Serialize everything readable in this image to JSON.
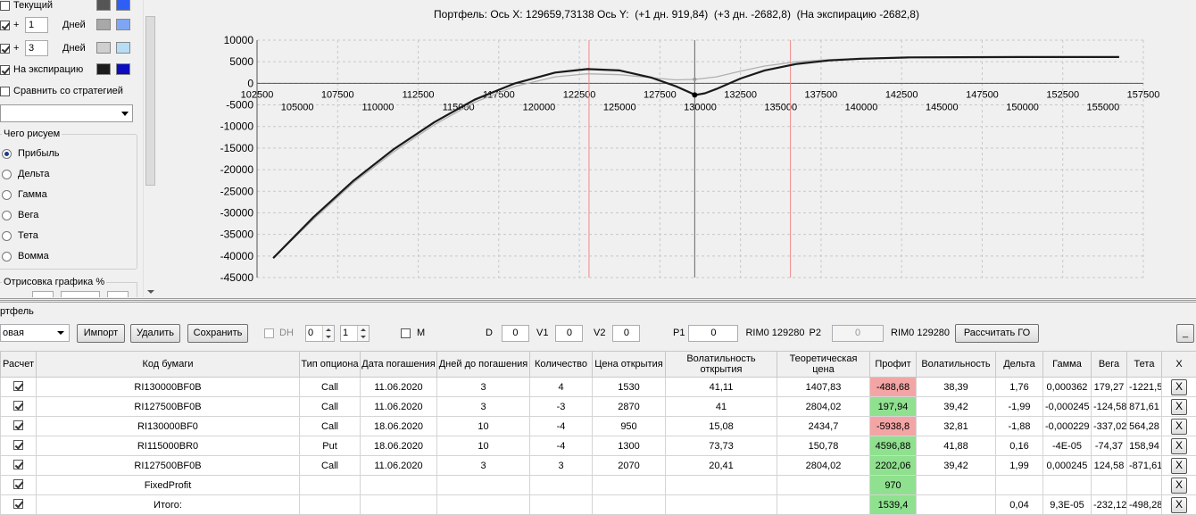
{
  "left_panel": {
    "rows": [
      {
        "label": "Текущий",
        "checked": false,
        "has_days": false,
        "color1": "#555555",
        "color2": "#2f5ef5"
      },
      {
        "prefix": "+",
        "days": "1",
        "days_label": "Дней",
        "checked": true,
        "has_days": true,
        "color1": "#a8a8a8",
        "color2": "#7fa6f5"
      },
      {
        "prefix": "+",
        "days": "3",
        "days_label": "Дней",
        "checked": true,
        "has_days": true,
        "color1": "#cfcfcf",
        "color2": "#b7dcf6"
      },
      {
        "label": "На экспирацию",
        "checked": true,
        "has_days": false,
        "color1": "#1c1c1c",
        "color2": "#0d0dbf"
      }
    ],
    "compare_label": "Сравнить со стратегией",
    "what_group_title": "Чего рисуем",
    "what_options": [
      {
        "label": "Прибыль",
        "selected": true
      },
      {
        "label": "Дельта",
        "selected": false
      },
      {
        "label": "Гамма",
        "selected": false
      },
      {
        "label": "Вега",
        "selected": false
      },
      {
        "label": "Тета",
        "selected": false
      },
      {
        "label": "Вомма",
        "selected": false
      }
    ],
    "draw_group_title": "Отрисовка графика %"
  },
  "chart": {
    "title": "Портфель: Ось X: 129659,73138 Ось Y:  (+1 дн. 919,84)  (+3 дн. -2682,8)  (На экспирацию -2682,8)"
  },
  "chart_data": {
    "type": "line",
    "title": "Портфель: Ось X: 129659,73138 Ось Y:  (+1 дн. 919,84)  (+3 дн. -2682,8)  (На экспирацию -2682,8)",
    "xlim": [
      102500,
      157500
    ],
    "ylim": [
      -45000,
      10000
    ],
    "x_ticks_upper": [
      "102500",
      "107500",
      "112500",
      "117500",
      "122500",
      "127500",
      "132500",
      "137500",
      "142500",
      "147500",
      "152500",
      "157500"
    ],
    "x_ticks_lower": [
      "105000",
      "110000",
      "115000",
      "120000",
      "125000",
      "130000",
      "135000",
      "140000",
      "145000",
      "150000",
      "155000"
    ],
    "y_ticks": [
      "10000",
      "5000",
      "0",
      "-5000",
      "-10000",
      "-15000",
      "-20000",
      "-25000",
      "-30000",
      "-35000",
      "-40000",
      "-45000"
    ],
    "grid": true,
    "cursor_x": 129659.73,
    "red_lines_x": [
      123100,
      135600
    ],
    "series": [
      {
        "color": "#1a1a1a",
        "x": [
          103500,
          106000,
          108500,
          111000,
          113500,
          116000,
          118500,
          121000,
          123000,
          125000,
          127000,
          128500,
          129700,
          130300,
          131000,
          132500,
          134000,
          136000,
          138000,
          140000,
          143000,
          146000,
          150000,
          153000,
          156000
        ],
        "y": [
          -40500,
          -31000,
          -22500,
          -15200,
          -9000,
          -3800,
          0,
          2500,
          3300,
          3000,
          1300,
          -700,
          -2700,
          -2300,
          -1300,
          1100,
          3000,
          4500,
          5300,
          5700,
          6000,
          6050,
          6100,
          6100,
          6100
        ]
      },
      {
        "color": "#b0b0b0",
        "x": [
          103500,
          106000,
          108500,
          111000,
          113500,
          116000,
          118500,
          121000,
          123000,
          125000,
          127000,
          128500,
          129700,
          131000,
          132500,
          134000,
          136000,
          138000,
          140000,
          143000,
          146000,
          150000,
          153000,
          156000
        ],
        "y": [
          -40500,
          -31500,
          -23000,
          -15800,
          -9600,
          -4400,
          -700,
          1500,
          2200,
          2000,
          1300,
          800,
          920,
          1500,
          2800,
          4000,
          5000,
          5500,
          5800,
          6000,
          6050,
          6100,
          6100,
          6100
        ]
      }
    ]
  },
  "portfolio": {
    "section_label": "ртфель",
    "dropdown_value": "овая",
    "import_label": "Импорт",
    "delete_label": "Удалить",
    "save_label": "Сохранить",
    "dh_label": "DH",
    "dh_spin1": "0",
    "dh_spin2": "1",
    "m_label": "M",
    "d_label": "D",
    "d_value": "0",
    "v1_label": "V1",
    "v1_value": "0",
    "v2_label": "V2",
    "v2_value": "0",
    "p1_label": "P1",
    "p1_value": "0",
    "p1_instrument": "RIM0 129280",
    "p2_label": "P2",
    "p2_value": "0",
    "p2_instrument": "RIM0 129280",
    "calc_go_label": "Рассчитать ГО",
    "minimize_label": "_"
  },
  "table": {
    "headers": [
      "Расчет",
      "Код бумаги",
      "Тип опциона",
      "Дата погашения",
      "Дней до погашения",
      "Количество",
      "Цена открытия",
      "Волатильность открытия",
      "Теоретическая цена",
      "Профит",
      "Волатильность",
      "Дельта",
      "Гамма",
      "Вега",
      "Тета",
      "X"
    ],
    "rows": [
      {
        "checked": true,
        "code": "RI130000BF0B",
        "type": "Call",
        "date": "11.06.2020",
        "days": "3",
        "qty": "4",
        "open_price": "1530",
        "open_vol": "41,11",
        "theo": "1407,83",
        "profit": "-488,68",
        "profit_color": "red",
        "vol": "38,39",
        "delta": "1,76",
        "gamma": "0,000362",
        "vega": "179,27",
        "theta": "-1221,5",
        "x": "X"
      },
      {
        "checked": true,
        "code": "RI127500BF0B",
        "type": "Call",
        "date": "11.06.2020",
        "days": "3",
        "qty": "-3",
        "open_price": "2870",
        "open_vol": "41",
        "theo": "2804,02",
        "profit": "197,94",
        "profit_color": "green",
        "vol": "39,42",
        "delta": "-1,99",
        "gamma": "-0,000245",
        "vega": "-124,58",
        "theta": "871,61",
        "x": "X"
      },
      {
        "checked": true,
        "code": "RI130000BF0",
        "type": "Call",
        "date": "18.06.2020",
        "days": "10",
        "qty": "-4",
        "open_price": "950",
        "open_vol": "15,08",
        "theo": "2434,7",
        "profit": "-5938,8",
        "profit_color": "red",
        "vol": "32,81",
        "delta": "-1,88",
        "gamma": "-0,000229",
        "vega": "-337,02",
        "theta": "564,28",
        "x": "X"
      },
      {
        "checked": true,
        "code": "RI115000BR0",
        "type": "Put",
        "date": "18.06.2020",
        "days": "10",
        "qty": "-4",
        "open_price": "1300",
        "open_vol": "73,73",
        "theo": "150,78",
        "profit": "4596,88",
        "profit_color": "green",
        "vol": "41,88",
        "delta": "0,16",
        "gamma": "-4E-05",
        "vega": "-74,37",
        "theta": "158,94",
        "x": "X"
      },
      {
        "checked": true,
        "code": "RI127500BF0B",
        "type": "Call",
        "date": "11.06.2020",
        "days": "3",
        "qty": "3",
        "open_price": "2070",
        "open_vol": "20,41",
        "theo": "2804,02",
        "profit": "2202,06",
        "profit_color": "green",
        "vol": "39,42",
        "delta": "1,99",
        "gamma": "0,000245",
        "vega": "124,58",
        "theta": "-871,61",
        "x": "X"
      },
      {
        "checked": true,
        "code": "FixedProfit",
        "type": "",
        "date": "",
        "days": "",
        "qty": "",
        "open_price": "",
        "open_vol": "",
        "theo": "",
        "profit": "970",
        "profit_color": "green",
        "vol": "",
        "delta": "",
        "gamma": "",
        "vega": "",
        "theta": "",
        "x": "X"
      },
      {
        "checked": true,
        "code": "Итого:",
        "type": "",
        "date": "",
        "days": "",
        "qty": "",
        "open_price": "",
        "open_vol": "",
        "theo": "",
        "profit": "1539,4",
        "profit_color": "green",
        "vol": "",
        "delta": "0,04",
        "gamma": "9,3E-05",
        "vega": "-232,12",
        "theta": "-498,28",
        "x": "X"
      }
    ]
  }
}
